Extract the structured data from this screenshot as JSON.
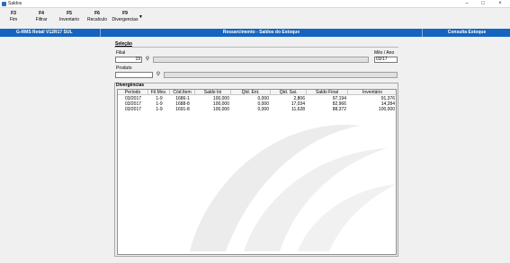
{
  "window": {
    "title": "Saldos"
  },
  "toolbar": {
    "buttons": [
      {
        "key": "F3",
        "label": "Fim"
      },
      {
        "key": "F4",
        "label": "Filtrar"
      },
      {
        "key": "F5",
        "label": "Inventario"
      },
      {
        "key": "F6",
        "label": "Recalculo"
      },
      {
        "key": "F9",
        "label": "Divergencias"
      }
    ]
  },
  "header": {
    "left": "G-RMS Retail V12R17 SUL",
    "center": "Ressarcimento - Saldos do Estoque",
    "right": "Consulta Estoque"
  },
  "selection": {
    "title": "Seleção",
    "filial_label": "Filial",
    "filial_value": "19",
    "mes_label": "Mês / Ano",
    "mes_value": "03/17",
    "produto_label": "Produto",
    "produto_value": ""
  },
  "divergences": {
    "title": "Divergências",
    "columns": [
      "Período",
      "Fil.Mov.",
      "Cód.Item",
      "Saldo Ini",
      "Qtd. Ent.",
      "Qtd. Sai.",
      "Saldo Final",
      "Inventário"
    ],
    "rows": [
      [
        "03/2017",
        "1-9",
        "1686-1",
        "100,000",
        "0,000",
        "2,806",
        "97,194",
        "91,376"
      ],
      [
        "03/2017",
        "1-9",
        "1688-8",
        "100,000",
        "0,000",
        "17,034",
        "82,966",
        "14,284"
      ],
      [
        "03/2017",
        "1-9",
        "1691-8",
        "100,000",
        "0,000",
        "11,628",
        "88,372",
        "100,000"
      ]
    ]
  },
  "colors": {
    "header_blue": "#1565c0",
    "background": "#f0f0f0"
  }
}
